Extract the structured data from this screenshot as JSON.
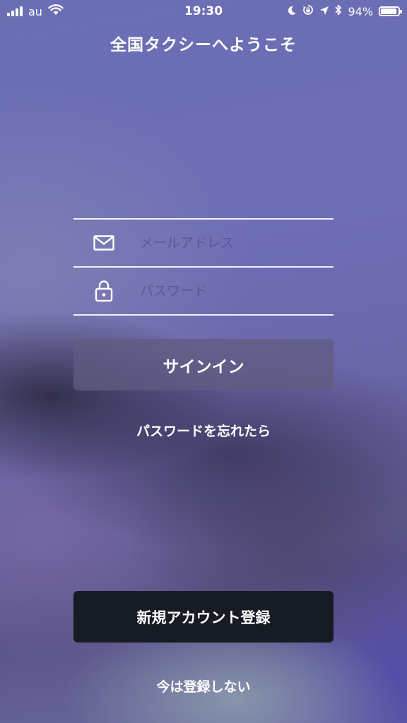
{
  "status_bar": {
    "carrier": "au",
    "time": "19:30",
    "battery_percent": "94%",
    "battery_level": 0.94,
    "icons": [
      "signal-icon",
      "wifi-icon",
      "moon-icon",
      "rotation-lock-icon",
      "location-arrow-icon",
      "bluetooth-icon",
      "battery-icon"
    ]
  },
  "header": {
    "title": "全国タクシーへようこそ"
  },
  "login_form": {
    "email_placeholder": "メールアドレス",
    "email_value": "",
    "email_icon": "mail-icon",
    "password_placeholder": "パスワード",
    "password_value": "",
    "password_icon": "lock-icon",
    "signin_label": "サインイン",
    "forgot_label": "パスワードを忘れたら"
  },
  "footer": {
    "register_label": "新規アカウント登録",
    "skip_label": "今は登録しない"
  },
  "colors": {
    "register_button": "#171c24",
    "signin_button": "#5f5c82",
    "text": "#ffffff"
  }
}
